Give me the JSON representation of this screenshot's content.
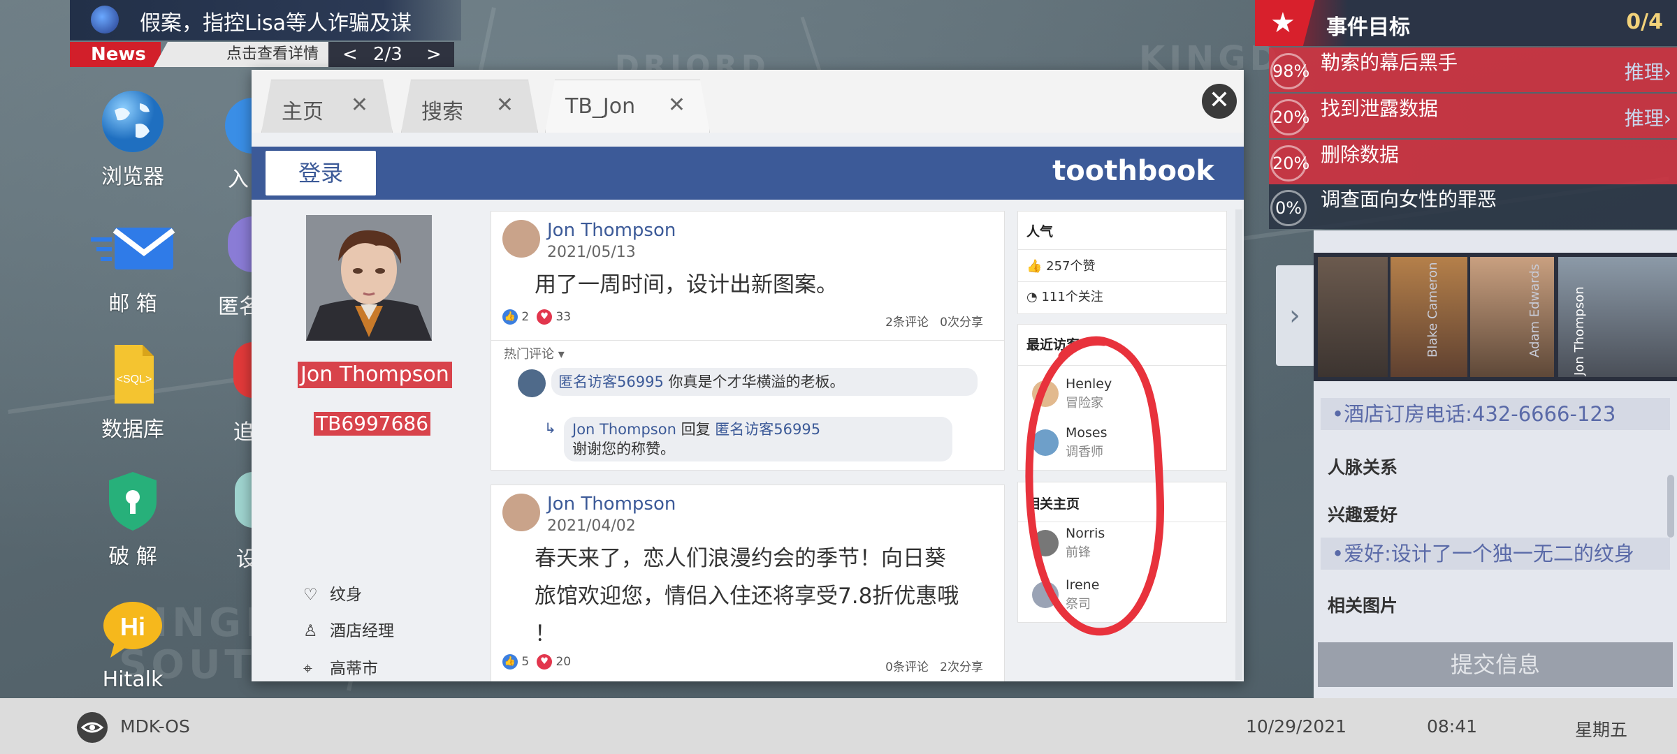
{
  "news": {
    "headline": "假案，指控Lisa等人诈骗及谋",
    "label": "News",
    "detail": "点击查看详情",
    "prev": "<",
    "page": "2/3",
    "next": ">"
  },
  "desktop": {
    "icons": [
      {
        "label": "浏览器"
      },
      {
        "label": "邮 箱"
      },
      {
        "label": "数据库"
      },
      {
        "label": "破 解"
      },
      {
        "label": "Hitalk"
      }
    ],
    "partial_labels": [
      "入",
      "匿名",
      "追",
      "设"
    ],
    "sql_text": "<SQL>",
    "hitalk_text": "Hi"
  },
  "browser": {
    "tabs": [
      {
        "label": "主页",
        "close": "✕"
      },
      {
        "label": "搜索",
        "close": "✕"
      },
      {
        "label": "TB_Jon",
        "close": "✕"
      }
    ],
    "close_glyph": "✕",
    "login": "登录",
    "brand": "toothbook"
  },
  "profile": {
    "name": "Jon Thompson",
    "id": "TB6997686",
    "info": [
      {
        "icon": "heart-outline-icon",
        "glyph": "♡",
        "text": "纹身"
      },
      {
        "icon": "tie-icon",
        "glyph": "♙",
        "text": "酒店经理"
      },
      {
        "icon": "location-icon",
        "glyph": "⌖",
        "text": "高蒂市"
      }
    ]
  },
  "posts": [
    {
      "author": "Jon Thompson",
      "date": "2021/05/13",
      "text": "用了一周时间，设计出新图案。",
      "likes": "2",
      "hearts": "33",
      "comments": "2条评论",
      "shares": "0次分享",
      "hot_label": "热门评论 ▾",
      "comment": {
        "user": "匿名访客56995",
        "text": "你真是个才华横溢的老板。"
      },
      "reply": {
        "user": "Jon Thompson",
        "verb": "回复",
        "target": "匿名访客56995",
        "text": "谢谢您的称赞。"
      }
    },
    {
      "author": "Jon Thompson",
      "date": "2021/04/02",
      "text_lines": [
        "春天来了，恋人们浪漫约会的季节！向日葵",
        "旅馆欢迎您，情侣入住还将享受7.8折优惠哦",
        "！"
      ],
      "likes": "5",
      "hearts": "20",
      "comments": "0条评论",
      "shares": "2次分享"
    }
  ],
  "sidebar": {
    "popularity_title": "人气",
    "likes": "257个赞",
    "follows": "111个关注",
    "recent_title": "最近访客",
    "visitors": [
      {
        "name": "Henley",
        "role": "冒险家"
      },
      {
        "name": "Moses",
        "role": "调香师"
      }
    ],
    "related_title": "相关主页",
    "related": [
      {
        "name": "Norris",
        "role": "前锋"
      },
      {
        "name": "Irene",
        "role": "祭司"
      }
    ]
  },
  "goals": {
    "title": "事件目标",
    "count": "0/4",
    "items": [
      {
        "pct": "98%",
        "text": "勒索的幕后黑手",
        "action": "推理›",
        "state": "red"
      },
      {
        "pct": "20%",
        "text": "找到泄露数据",
        "action": "推理›",
        "state": "red"
      },
      {
        "pct": "20%",
        "text": "删除数据",
        "action": "",
        "state": "red"
      },
      {
        "pct": "0%",
        "text": "调查面向女性的罪恶",
        "action": "",
        "state": "dark"
      }
    ]
  },
  "profile_panel": {
    "arrow": "›",
    "portrait_names": [
      "Blake Cameron",
      "Adam Edwards",
      "Jon Thompson"
    ],
    "phone": "•酒店订房电话:432-6666-123",
    "relations": "人脉关系",
    "hobbies": "兴趣爱好",
    "hobby": "•爱好:设计了一个独一无二的纹身",
    "images": "相关图片",
    "submit": "提交信息"
  },
  "taskbar": {
    "os": "MDK-OS",
    "date": "10/29/2021",
    "time": "08:41",
    "day": "星期五"
  },
  "colors": {
    "facebook_blue": "#3c5a98",
    "highlight_red": "#d8434b",
    "goal_red": "#d62e3c",
    "annotation_red": "#e8323c"
  }
}
